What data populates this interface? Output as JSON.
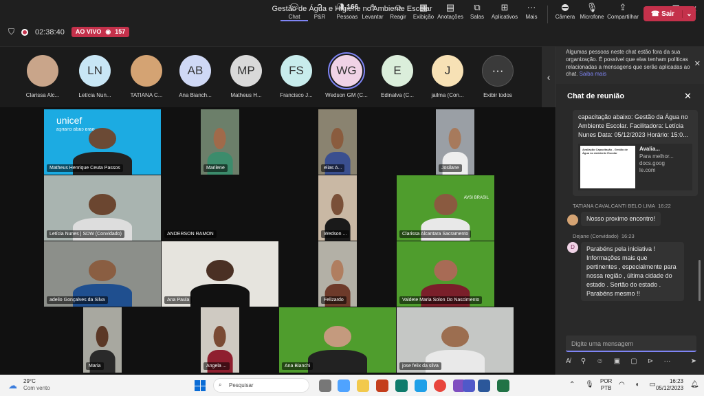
{
  "window": {
    "title": "Gestão de Água e Higiene no Ambiente Escolar"
  },
  "toolbar": {
    "timer": "02:38:40",
    "live_label": "AO VIVO",
    "viewers": "157",
    "people_count": "166",
    "buttons": {
      "chat": "Chat",
      "qa": "P&R",
      "people": "Pessoas",
      "raise": "Levantar",
      "react": "Reagir",
      "view": "Exibição",
      "notes": "Anotações",
      "rooms": "Salas",
      "apps": "Aplicativos",
      "more": "Mais",
      "camera": "Câmera",
      "mic": "Microfone",
      "share": "Compartilhar",
      "leave": "Sair"
    }
  },
  "strip": {
    "participants": [
      {
        "initials": "",
        "name": "Clarissa Alc...",
        "color": "#c9a58a"
      },
      {
        "initials": "LN",
        "name": "Letícia Nun...",
        "color": "#c8e6f5"
      },
      {
        "initials": "",
        "name": "TATIANA C...",
        "color": "#d4a373"
      },
      {
        "initials": "AB",
        "name": "Ana Bianch...",
        "color": "#cfd8f5"
      },
      {
        "initials": "MP",
        "name": "Matheus H...",
        "color": "#d9d9d9"
      },
      {
        "initials": "FS",
        "name": "Francisco J...",
        "color": "#c8ecec"
      },
      {
        "initials": "WG",
        "name": "Wedson GM (C...",
        "color": "#f0d3e6"
      },
      {
        "initials": "E",
        "name": "Edinalva (C...",
        "color": "#dbeedb"
      },
      {
        "initials": "J",
        "name": "jailma (Con...",
        "color": "#f7e1b5"
      },
      {
        "initials": "···",
        "name": "Exibir todos",
        "color": "#3a3a3a"
      }
    ]
  },
  "tiles": {
    "t1": "Matheus Henrique Ceuta Passos",
    "t1_logo": "unicef",
    "t1_tag": "para cada criança",
    "t2": "Marilene",
    "t3": "elias A...",
    "t4": "Josilane",
    "t5": "Letícia Nunes | SDW (Convidado)",
    "t6": "ANDERSON RAMON",
    "t7": "Wedson ...",
    "t8": "Clarissa Alcantara Sacramento",
    "t9": "adelio Gonçalves da Silva",
    "t10": "Ana Paula",
    "t11": "Felizardo",
    "t12": "Valdete Maria Solon Do Nascimento",
    "t13": "Maria",
    "t14": "Angela ...",
    "t15": "Ana Bianchi",
    "t16": "jose felix da silva",
    "avsi": "AVSI BRASIL"
  },
  "panel": {
    "notice": "Algumas pessoas neste chat estão fora da sua organização. É possível que elas tenham políticas relacionadas a mensagens que serão aplicadas ao chat.",
    "notice_link": "Saiba mais",
    "title": "Chat de reunião",
    "msg1": "capacitação abaixo: Gestão da Água no Ambiente Escolar. Facilitadora: Letícia Nunes Data: 05/12/2023 Horário: 15:0...",
    "link_title": "Avalia...",
    "link_desc": "Para melhor...",
    "link_domain": "docs.google.com",
    "thumb_title": "Avaliação Capacitação - Gestão de Água no Ambiente Escolar",
    "m2_author": "TATIANA CAVALCANTI BELO LIMA",
    "m2_time": "16:22",
    "m2_text": "Nosso proximo encontro!",
    "m3_author": "Dejane (Convidado)",
    "m3_time": "16:23",
    "m3_initial": "D",
    "m3_text": "Parabéns pela iniciativa ! Informações mais que pertinentes , especialmente para nossa região , última cidade do estado . Sertão do estado . Parabéns mesmo !!",
    "compose_placeholder": "Digite uma mensagem"
  },
  "taskbar": {
    "temp": "29°C",
    "weather": "Com vento",
    "search": "Pesquisar",
    "lang1": "POR",
    "lang2": "PTB",
    "time": "16:23",
    "date": "05/12/2023"
  }
}
